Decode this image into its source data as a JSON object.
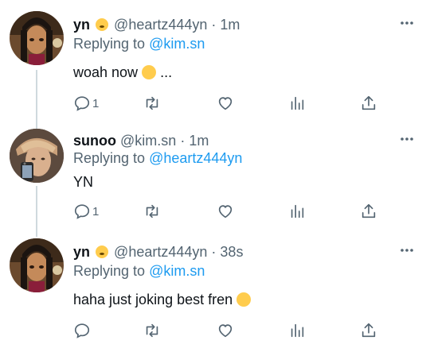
{
  "tweets": [
    {
      "name": "yn",
      "handle": "@heartz444yn",
      "separator": "·",
      "time": "1m",
      "replying_prefix": "Replying to",
      "replying_to": "@kim.sn",
      "text_before": "woah now",
      "text_after": "...",
      "reply_count": "1"
    },
    {
      "name": "sunoo",
      "handle": "@kim.sn",
      "separator": "·",
      "time": "1m",
      "replying_prefix": "Replying to",
      "replying_to": "@heartz444yn",
      "text": "YN",
      "reply_count": "1"
    },
    {
      "name": "yn",
      "handle": "@heartz444yn",
      "separator": "·",
      "time": "38s",
      "replying_prefix": "Replying to",
      "replying_to": "@kim.sn",
      "text": "haha just joking best fren",
      "reply_count": ""
    }
  ],
  "icons": {
    "reply": "reply-icon",
    "retweet": "retweet-icon",
    "like": "heart-icon",
    "views": "views-icon",
    "share": "share-icon",
    "more": "more-icon"
  },
  "colors": {
    "text": "#0f1419",
    "secondary": "#536471",
    "link": "#1d9bf0",
    "thread_line": "#cfd9de"
  }
}
